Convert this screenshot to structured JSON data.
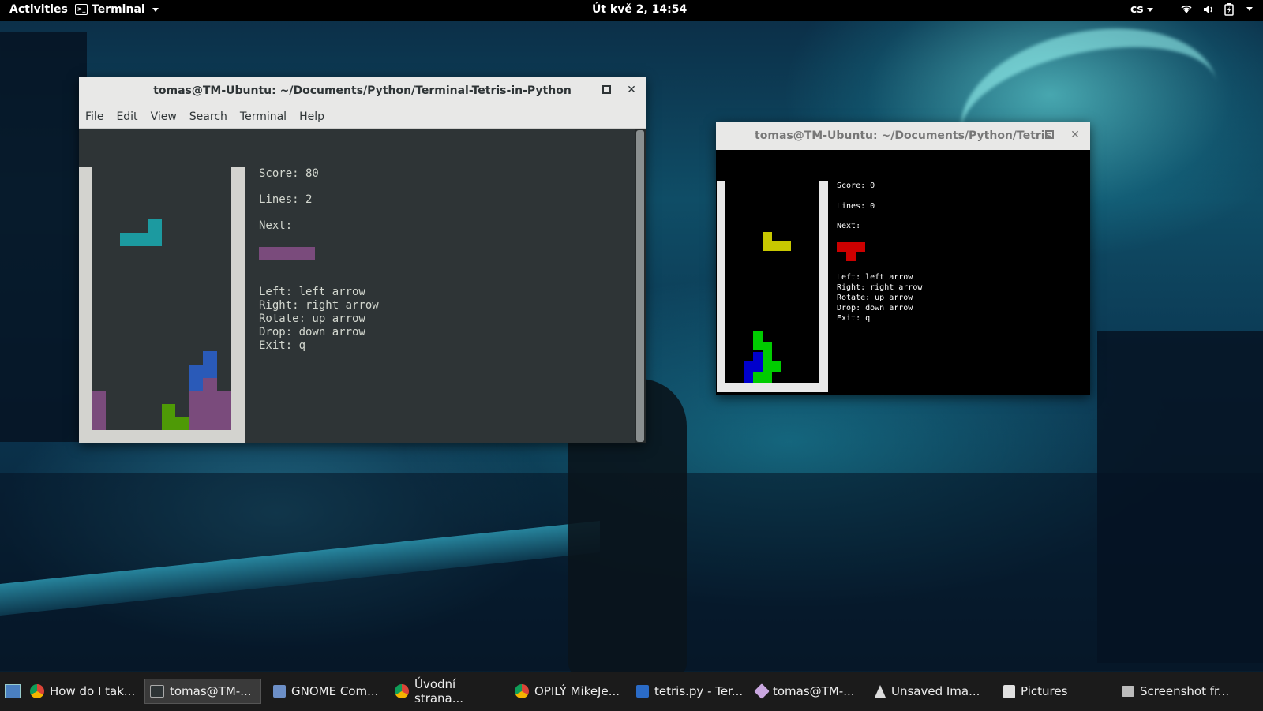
{
  "topbar": {
    "activities": "Activities",
    "app_name": "Terminal",
    "clock": "Út kvě  2, 14:54",
    "language": "cs",
    "tray_icons": [
      "wifi-icon",
      "volume-icon",
      "battery-icon",
      "chevron-down-icon"
    ]
  },
  "win1": {
    "title": "tomas@TM-Ubuntu: ~/Documents/Python/Terminal-Tetris-in-Python",
    "menu": [
      "File",
      "Edit",
      "View",
      "Search",
      "Terminal",
      "Help"
    ],
    "score": "Score: 80",
    "lines": "Lines: 2",
    "next": "Next:",
    "controls": [
      "Left: left arrow",
      "Right: right arrow",
      "Rotate: up arrow",
      "Drop: down arrow",
      "Exit: q"
    ],
    "colors": {
      "bg": "#2e3436",
      "border": "#d3d3cf",
      "current_piece": "#1c9aa0",
      "next_piece": "#7a4b7c",
      "piece_purple": "#7a4b7c",
      "piece_blue": "#2a5ab8",
      "piece_green": "#4e9a06"
    }
  },
  "win2": {
    "title": "tomas@TM-Ubuntu: ~/Documents/Python/Tetris",
    "score": "Score: 0",
    "lines": "Lines: 0",
    "next": "Next:",
    "controls": [
      "Left: left arrow",
      "Right: right arrow",
      "Rotate: up arrow",
      "Drop: down arrow",
      "Exit: q"
    ],
    "colors": {
      "bg": "#000000",
      "border": "#e8e8e8",
      "current_piece": "#c8c800",
      "next_piece": "#cc0000",
      "piece_green": "#00cc00",
      "piece_blue": "#0000cc"
    }
  },
  "taskbar": {
    "items": [
      {
        "label": "How do I tak...",
        "icon": "chrome-icon"
      },
      {
        "label": "tomas@TM-...",
        "icon": "terminal-icon"
      },
      {
        "label": "GNOME Com...",
        "icon": "gnome-commander-icon"
      },
      {
        "label": "Úvodní strana...",
        "icon": "chrome-icon"
      },
      {
        "label": "OPILÝ MikeJe...",
        "icon": "chrome-icon"
      },
      {
        "label": "tetris.py - Ter...",
        "icon": "vscode-icon"
      },
      {
        "label": "tomas@TM-...",
        "icon": "terminal-icon"
      },
      {
        "label": "Unsaved Ima...",
        "icon": "inkscape-icon"
      },
      {
        "label": "Pictures",
        "icon": "folder-icon"
      },
      {
        "label": "Screenshot fr...",
        "icon": "screenshot-icon"
      }
    ]
  }
}
